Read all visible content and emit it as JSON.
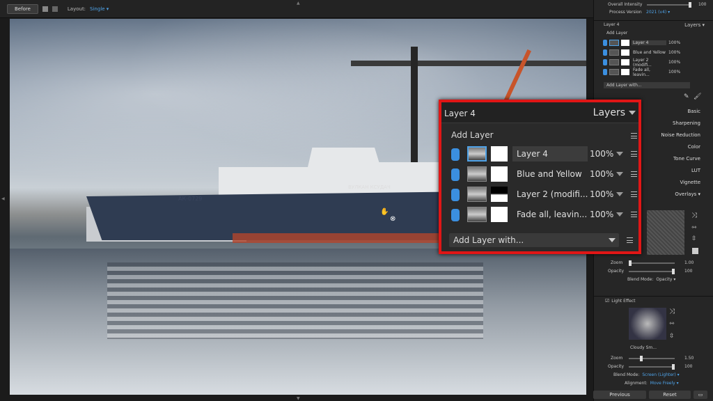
{
  "toolbar": {
    "before_label": "Before",
    "layout_label": "Layout:",
    "layout_value": "Single ▾"
  },
  "photo": {
    "ship_name_right": "ВУЛКАН КСУДАЧ",
    "ship_name_left": "АК-0729"
  },
  "panel": {
    "overall_intensity_label": "Overall Intensity",
    "overall_intensity_value": "100",
    "process_version_label": "Process Version",
    "process_version_value": "2021 (v4) ▾",
    "layer_title": "Layer 4",
    "layers_label": "Layers ▾",
    "add_layer_label": "Add Layer",
    "layers": [
      {
        "name": "Layer 4",
        "opacity": "100%"
      },
      {
        "name": "Blue and Yellow",
        "opacity": "100%"
      },
      {
        "name": "Layer 2 (modifi...",
        "opacity": "100%"
      },
      {
        "name": "Fade all, leavin...",
        "opacity": "100%"
      }
    ],
    "add_layer_with": "Add Layer with...",
    "menu": [
      "Basic",
      "Sharpening",
      "Noise Reduction",
      "Color",
      "Tone Curve",
      "LUT",
      "Vignette",
      "Overlays ▾"
    ],
    "overlay_zoom_label": "Zoom",
    "overlay_zoom_value": "1.00",
    "overlay_opacity_label": "Opacity",
    "overlay_opacity_value": "100",
    "overlay_blend_label": "Blend Mode:",
    "overlay_blend_value": "Opacity ▾",
    "light_effect_label": "Light Effect",
    "light_effect_preset": "Cloudy Sm...",
    "light_zoom_label": "Zoom",
    "light_zoom_value": "1.50",
    "light_opacity_label": "Opacity",
    "light_opacity_value": "100",
    "light_blend_label": "Blend Mode:",
    "light_blend_value": "Screen (Lighter) ▾",
    "alignment_label": "Alignment:",
    "alignment_value": "Move Freely ▾",
    "previous_label": "Previous",
    "reset_label": "Reset"
  },
  "callout": {
    "title": "Layer 4",
    "layers_label": "Layers",
    "add_layer_label": "Add Layer",
    "layers": [
      {
        "name": "Layer 4",
        "opacity": "100%",
        "selected": true
      },
      {
        "name": "Blue and Yellow",
        "opacity": "100%"
      },
      {
        "name": "Layer 2 (modifi...",
        "opacity": "100%"
      },
      {
        "name": "Fade all, leavin...",
        "opacity": "100%"
      }
    ],
    "add_layer_with": "Add Layer with..."
  },
  "colors": {
    "highlight_border": "#e01616",
    "accent": "#4fa3e8",
    "toggle_blue": "#3b8fe0"
  },
  "levels": {
    "overall_intensity": 1.0,
    "overlay_zoom": 0.0,
    "light_zoom": 0.25
  }
}
